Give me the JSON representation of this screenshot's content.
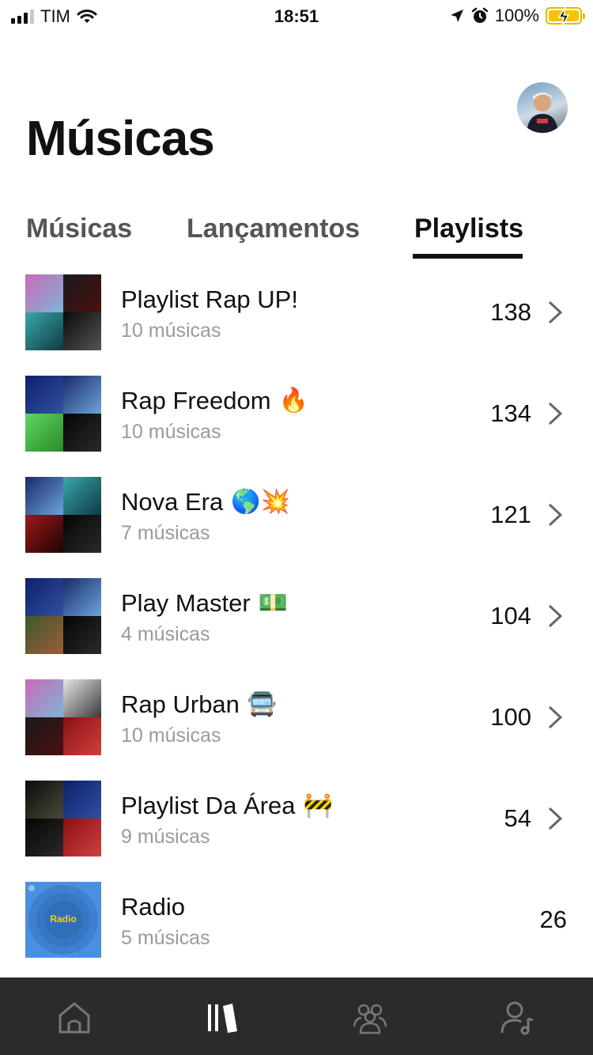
{
  "status_bar": {
    "carrier": "TIM",
    "time": "18:51",
    "battery": "100%"
  },
  "header": {
    "title": "Músicas"
  },
  "tabs": [
    {
      "label": "Músicas",
      "active": false
    },
    {
      "label": "Lançamentos",
      "active": false
    },
    {
      "label": "Playlists",
      "active": true
    }
  ],
  "playlists": [
    {
      "title": "Playlist Rap UP!",
      "emoji": "",
      "subtitle": "10 músicas",
      "count": "138",
      "chevron": true
    },
    {
      "title": "Rap Freedom",
      "emoji": "🔥",
      "subtitle": "10 músicas",
      "count": "134",
      "chevron": true
    },
    {
      "title": "Nova Era",
      "emoji": "🌎💥",
      "subtitle": "7 músicas",
      "count": "121",
      "chevron": true
    },
    {
      "title": "Play Master",
      "emoji": "💵",
      "subtitle": "4 músicas",
      "count": "104",
      "chevron": true
    },
    {
      "title": "Rap Urban",
      "emoji": "🚍",
      "subtitle": "10 músicas",
      "count": "100",
      "chevron": true
    },
    {
      "title": "Playlist Da Área",
      "emoji": "🚧",
      "subtitle": "9 músicas",
      "count": "54",
      "chevron": true
    },
    {
      "title": "Radio",
      "emoji": "",
      "subtitle": "5 músicas",
      "count": "26",
      "chevron": false,
      "cover_label": "Radio"
    }
  ],
  "bottom_nav": [
    {
      "icon": "home-icon",
      "active": false
    },
    {
      "icon": "library-icon",
      "active": true
    },
    {
      "icon": "community-icon",
      "active": false
    },
    {
      "icon": "artist-icon",
      "active": false
    }
  ],
  "colors": {
    "battery": "#f5c400",
    "nav_background": "#2b2b2b",
    "radio_cover": "#4a90e2"
  }
}
